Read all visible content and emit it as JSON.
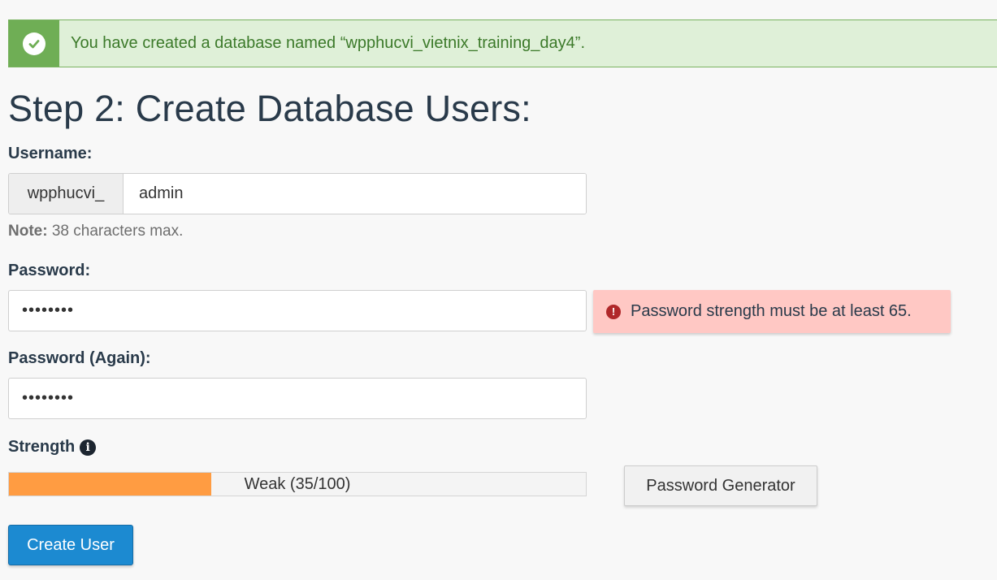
{
  "alert": {
    "icon": "check-circle-icon",
    "message": "You have created a database named “wpphucvi_vietnix_training_day4”.",
    "colors": {
      "background": "#dff0d8",
      "icon_cell": "#6fae55",
      "text": "#3c7a2a"
    }
  },
  "step_title": "Step 2: Create Database Users:",
  "username": {
    "label": "Username:",
    "prefix": "wpphucvi_",
    "value": "admin",
    "note_bold": "Note:",
    "note_text": " 38 characters max."
  },
  "password": {
    "label": "Password:",
    "value": "••••••••",
    "error_icon": "exclamation-circle-icon",
    "error_message": "Password strength must be at least 65."
  },
  "password_again": {
    "label": "Password (Again):",
    "value": "••••••••"
  },
  "strength": {
    "label": "Strength",
    "info_icon": "info-circle-icon",
    "score": 35,
    "max": 100,
    "text": "Weak (35/100)",
    "fill_color": "#ff9c42"
  },
  "buttons": {
    "password_generator": "Password Generator",
    "create_user": "Create User"
  }
}
